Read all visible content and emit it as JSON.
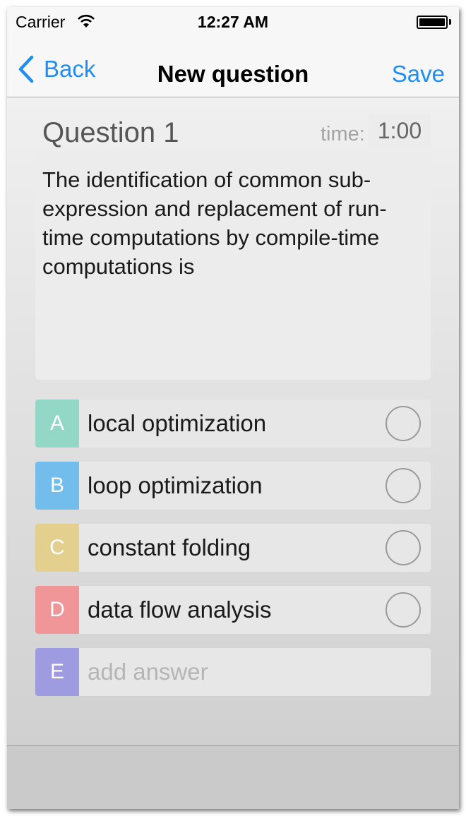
{
  "status_bar": {
    "carrier": "Carrier",
    "time": "12:27 AM"
  },
  "nav": {
    "back_label": "Back",
    "title": "New question",
    "save_label": "Save"
  },
  "question": {
    "title": "Question 1",
    "time_label": "time:",
    "time_value": "1:00",
    "text": "The identification of common sub-expression and replacement of run-time computations by compile-time computations is"
  },
  "answers": [
    {
      "letter": "A",
      "text": "local optimization",
      "color": "#93d8c6"
    },
    {
      "letter": "B",
      "text": "loop optimization",
      "color": "#73bdec"
    },
    {
      "letter": "C",
      "text": "constant folding",
      "color": "#e3d08f"
    },
    {
      "letter": "D",
      "text": "data flow analysis",
      "color": "#f09699"
    },
    {
      "letter": "E",
      "placeholder": "add answer",
      "color": "#9f9be1"
    }
  ],
  "colors": {
    "accent": "#1e8ef3"
  }
}
